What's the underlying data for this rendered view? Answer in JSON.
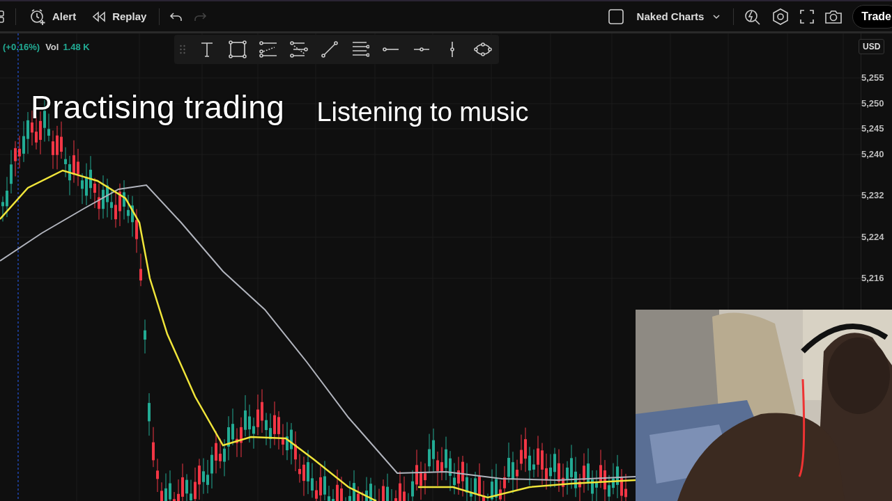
{
  "top_bar": {
    "left_buttons": [
      {
        "label": "Alert",
        "kind": "alert"
      },
      {
        "label": "Replay",
        "kind": "replay"
      }
    ],
    "history": [
      {
        "kind": "undo",
        "disabled": false
      },
      {
        "kind": "redo",
        "disabled": true
      }
    ],
    "layout": {
      "label": "Naked Charts"
    },
    "trade_button": "Trade"
  },
  "legend": {
    "change": "(+0.16%)",
    "volume_label": "Vol",
    "volume_value": "1.48 K"
  },
  "overlay_texts": [
    {
      "text": "Practising trading",
      "kind": "outlined"
    },
    {
      "text": "Listening to music",
      "kind": "plain"
    }
  ],
  "price_axis": {
    "currency": "USD",
    "prices": [
      "5,255",
      "5,250",
      "5,245",
      "5,240",
      "5,232",
      "5,224",
      "5,216"
    ]
  }
}
